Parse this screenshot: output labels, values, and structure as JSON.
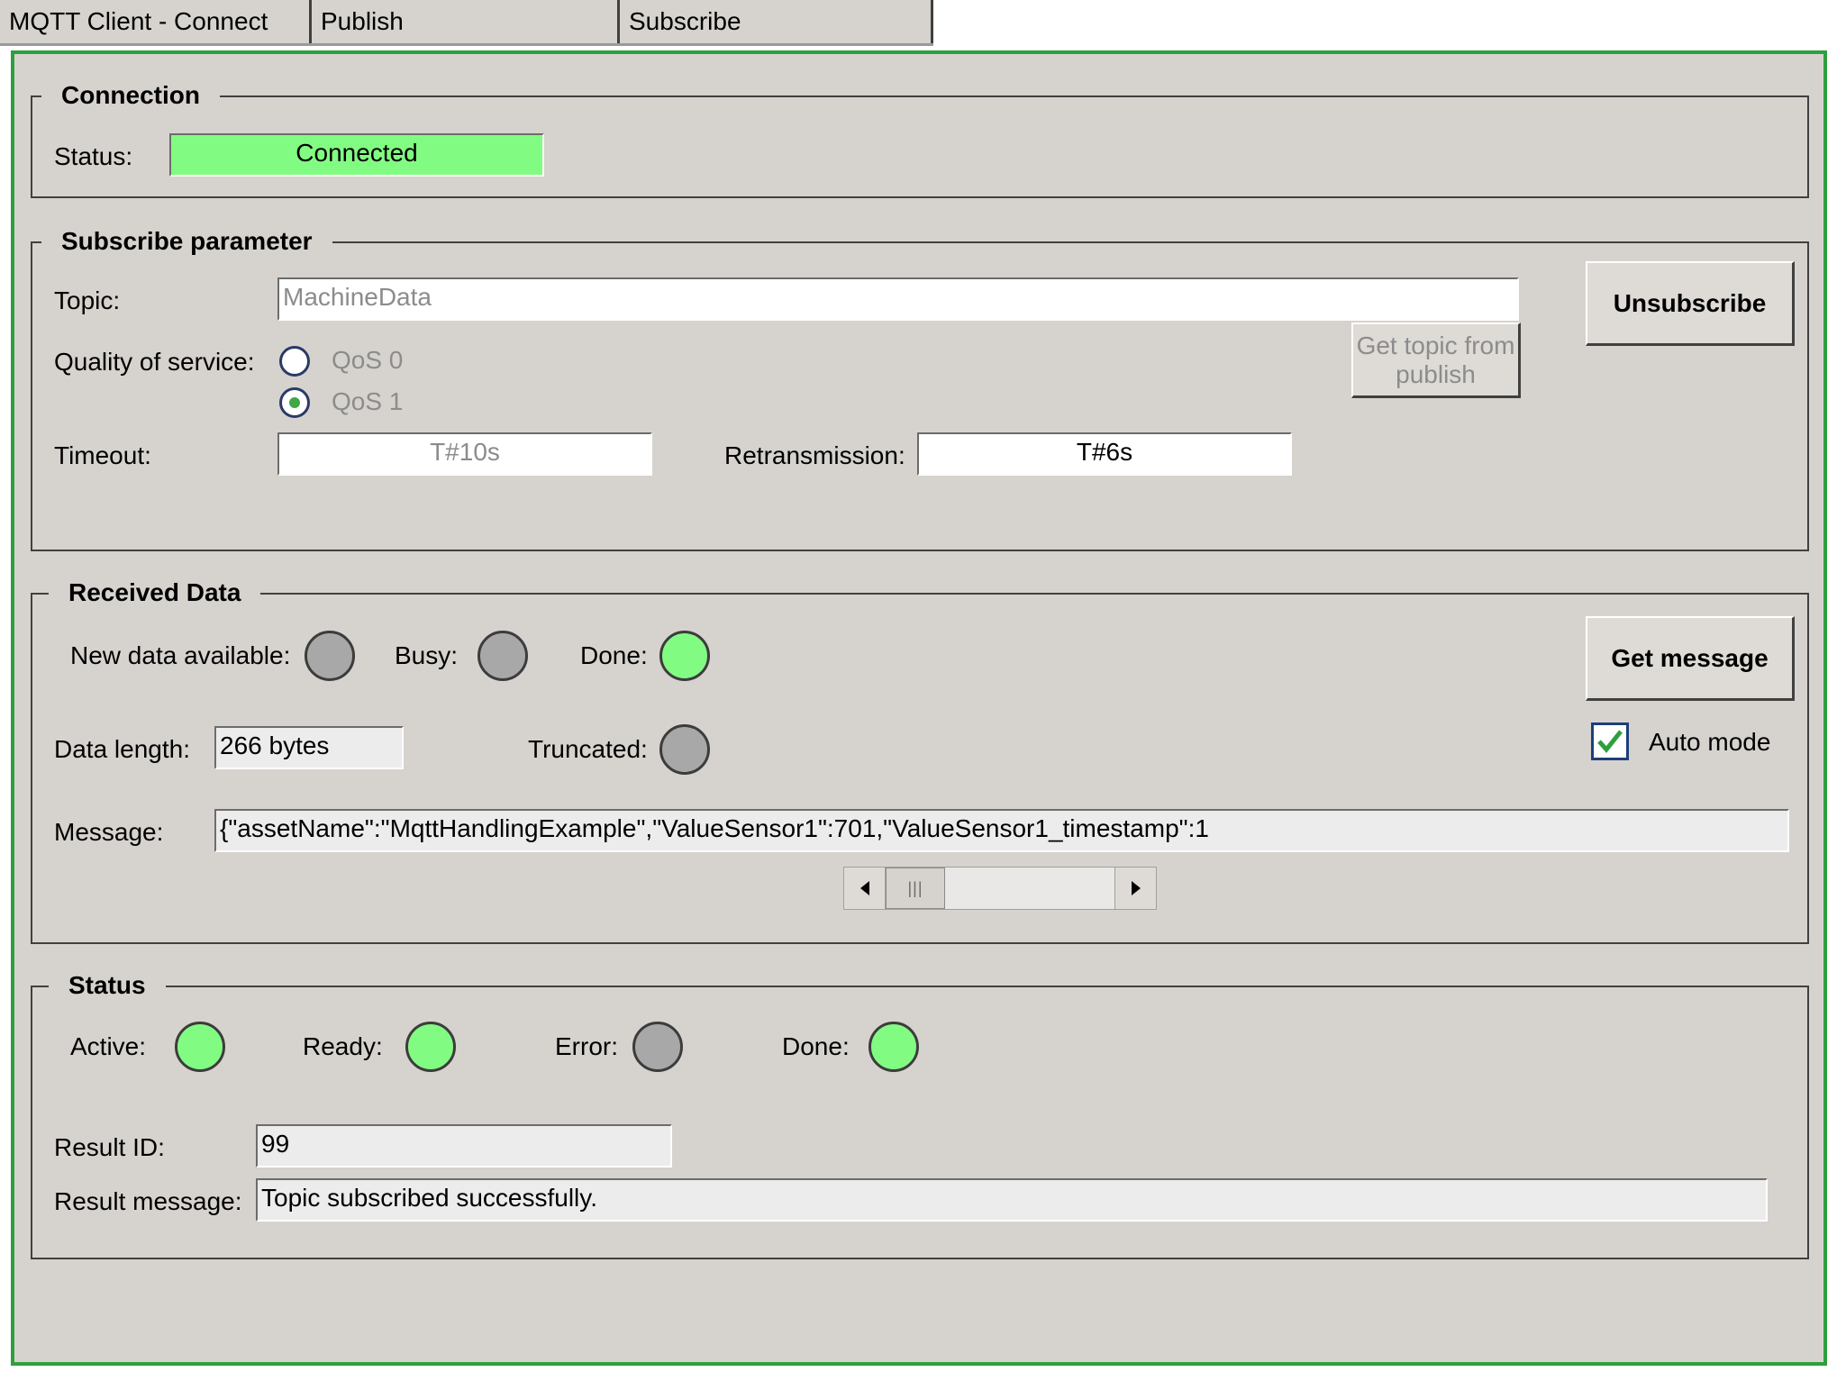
{
  "tabs": [
    {
      "label": "MQTT Client - Connect"
    },
    {
      "label": "Publish"
    },
    {
      "label": "Subscribe"
    }
  ],
  "connection": {
    "legend": "Connection",
    "status_label": "Status:",
    "status_value": "Connected",
    "status_color": "#82fb82"
  },
  "subscribe": {
    "legend": "Subscribe parameter",
    "topic_label": "Topic:",
    "topic_value": "MachineData",
    "get_topic_label": "Get topic from publish",
    "unsubscribe_label": "Unsubscribe",
    "qos_label": "Quality of service:",
    "qos_options": [
      {
        "label": "QoS 0",
        "selected": false
      },
      {
        "label": "QoS 1",
        "selected": true
      }
    ],
    "timeout_label": "Timeout:",
    "timeout_value": "T#10s",
    "retransmission_label": "Retransmission:",
    "retransmission_value": "T#6s"
  },
  "received": {
    "legend": "Received Data",
    "new_data_label": "New data available:",
    "new_data_state": "off",
    "busy_label": "Busy:",
    "busy_state": "off",
    "done_label": "Done:",
    "done_state": "on",
    "get_message_label": "Get message",
    "data_length_label": "Data length:",
    "data_length_value": "266 bytes",
    "truncated_label": "Truncated:",
    "truncated_state": "off",
    "auto_mode_label": "Auto mode",
    "auto_mode_checked": true,
    "message_label": "Message:",
    "message_value": "{\"assetName\":\"MqttHandlingExample\",\"ValueSensor1\":701,\"ValueSensor1_timestamp\":1"
  },
  "status": {
    "legend": "Status",
    "active_label": "Active:",
    "active_state": "on",
    "ready_label": "Ready:",
    "ready_state": "on",
    "error_label": "Error:",
    "error_state": "off",
    "done_label": "Done:",
    "done_state": "on",
    "result_id_label": "Result ID:",
    "result_id_value": "99",
    "result_message_label": "Result message:",
    "result_message_value": "Topic subscribed successfully."
  },
  "colors": {
    "panel_bg": "#d6d3ce",
    "panel_border": "#2e9f3e",
    "led_on": "#82fb82",
    "led_off": "#a8a8a8"
  },
  "icons": {
    "scroll_left": "triangle-left-icon",
    "scroll_right": "triangle-right-icon",
    "checkbox_check": "checkmark-icon"
  }
}
